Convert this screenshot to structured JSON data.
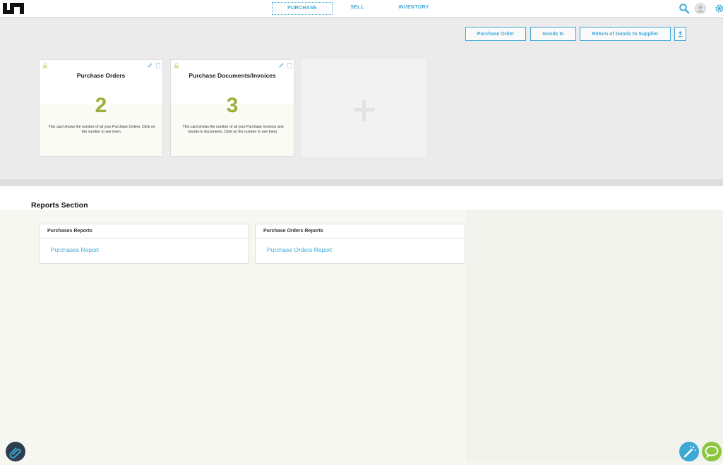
{
  "nav": {
    "tabs": [
      {
        "label": "PURCHASE",
        "active": true
      },
      {
        "label": "SELL",
        "active": false
      },
      {
        "label": "INVENTORY",
        "active": false
      }
    ],
    "icons": [
      "search-icon",
      "user-avatar-icon",
      "gear-icon"
    ]
  },
  "actions": {
    "purchase_order": "Purchase Order",
    "goods_in": "Goods In",
    "return_goods": "Return of Goods to Supplier",
    "export_icon": "upload-icon"
  },
  "cards": [
    {
      "title": "Purchase Orders",
      "count": "2",
      "description": "This card shows the number of all your Purchase Orders. Click on the number to see them."
    },
    {
      "title": "Purchase Documents/Invoices",
      "count": "3",
      "description": "This card shows the number of all your Purchase Invoices and Goods-In documents. Click on the number to see them."
    }
  ],
  "add_card_icon": "plus-icon",
  "reports": {
    "section_title": "Reports Section",
    "panels": [
      {
        "header": "Purchases Reports",
        "link": "Purchases Report"
      },
      {
        "header": "Purchase Orders Reports",
        "link": "Purchase Orders Report"
      }
    ]
  },
  "colors": {
    "accent": "#3fa9d6",
    "count_green": "#9ab03a",
    "chat_green": "#8cc63f"
  }
}
